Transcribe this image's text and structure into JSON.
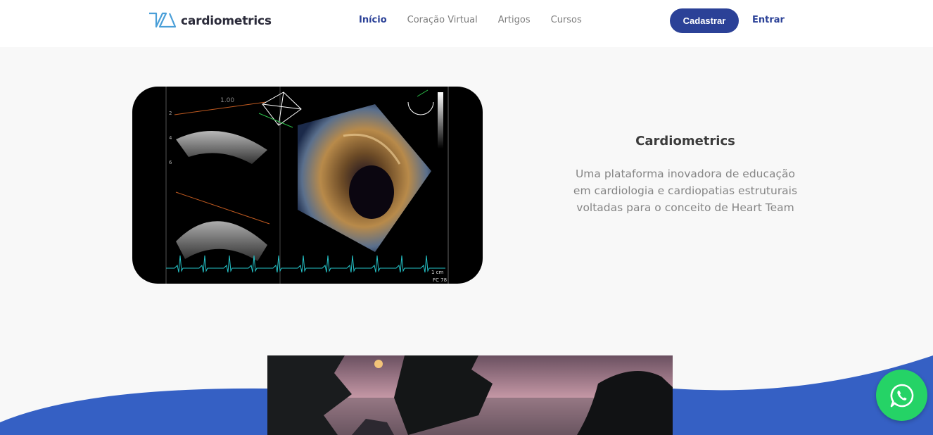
{
  "header": {
    "logo_text": "cardiometrics",
    "nav": [
      {
        "label": "Início",
        "active": true
      },
      {
        "label": "Coração Virtual",
        "active": false
      },
      {
        "label": "Artigos",
        "active": false
      },
      {
        "label": "Cursos",
        "active": false
      }
    ],
    "signup_label": "Cadastrar",
    "login_label": "Entrar"
  },
  "hero": {
    "image_texts": {
      "scale_value": "1.00",
      "depth_2": "2",
      "depth_4": "4",
      "depth_6": "6",
      "scale_cm": "1 cm",
      "heart_rate": "FC 78"
    },
    "title": "Cardiometrics",
    "description": "Uma plataforma inovadora de educação em cardiologia e cardiopatias estruturais voltadas para o conceito de Heart Team"
  },
  "floating": {
    "icon": "whatsapp-icon"
  },
  "colors": {
    "brand_blue": "#2b4197",
    "wave_blue": "#2f5fc4",
    "whatsapp_green": "#25d366",
    "background": "#f8f8f8"
  }
}
